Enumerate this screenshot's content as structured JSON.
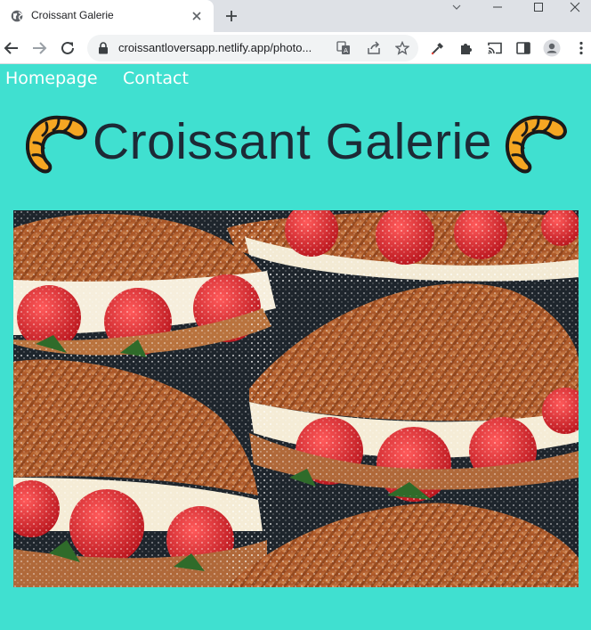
{
  "browser": {
    "tab_title": "Croissant Galerie",
    "url": "croissantloversapp.netlify.app/photo...",
    "icons": [
      "globe-icon",
      "close-icon",
      "plus-icon",
      "minimize-icon",
      "maximize-icon",
      "close-window-icon",
      "back-icon",
      "forward-icon",
      "reload-icon",
      "lock-icon",
      "translate-icon",
      "share-icon",
      "star-icon",
      "eyedropper-icon",
      "puzzle-icon",
      "cast-icon",
      "sidepanel-icon",
      "profile-icon",
      "menu-icon"
    ]
  },
  "nav": {
    "items": [
      "Homepage",
      "Contact"
    ]
  },
  "page": {
    "title": "Croissant Galerie",
    "background": "#40e0d0",
    "title_color": "#1d2a36",
    "image_description_icon": "croissant-emoji-icon",
    "photo_subject": "strawberry-cream-croissants-photo"
  }
}
